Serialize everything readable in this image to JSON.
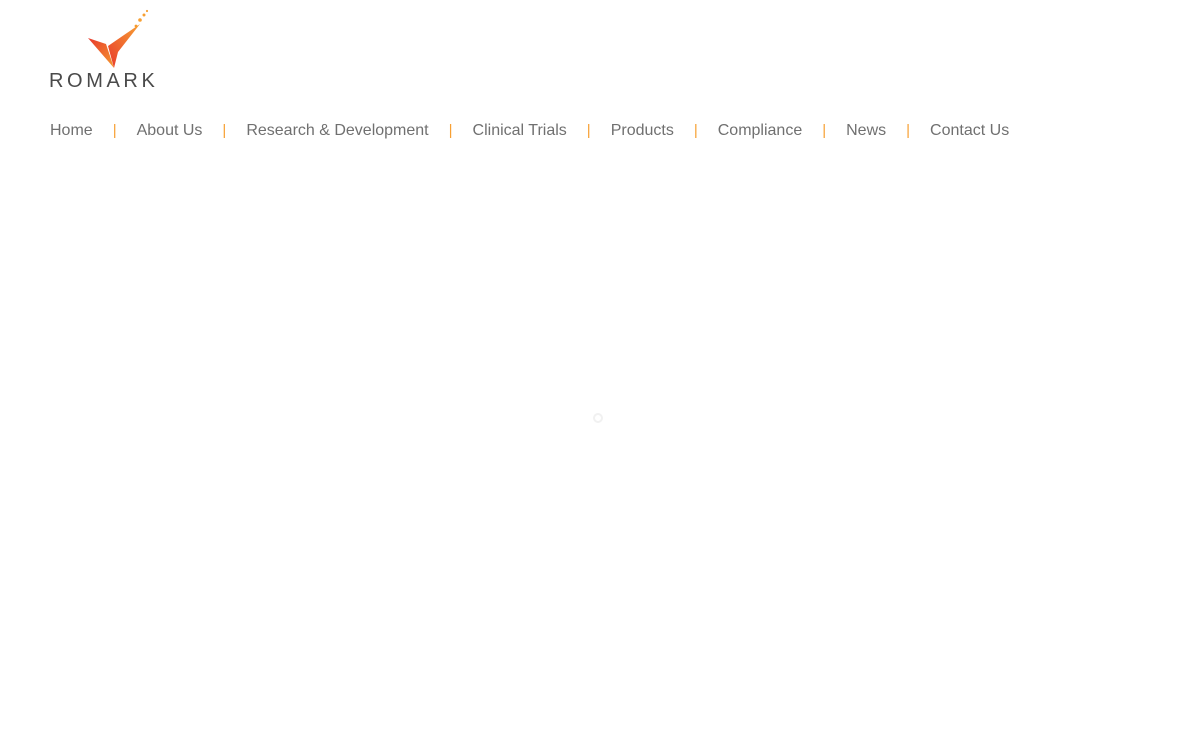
{
  "brand": {
    "logo_text": "ROMARK",
    "colors": {
      "accent_orange": "#f7a033",
      "accent_red": "#e8392c",
      "text_gray": "#707070",
      "wordmark": "#4a4a4a"
    }
  },
  "nav": {
    "items": [
      {
        "label": "Home"
      },
      {
        "label": "About Us"
      },
      {
        "label": "Research & Development"
      },
      {
        "label": "Clinical Trials"
      },
      {
        "label": "Products"
      },
      {
        "label": "Compliance"
      },
      {
        "label": "News"
      },
      {
        "label": "Contact Us"
      }
    ],
    "separator": "|"
  },
  "main": {
    "loader_icon": "loading-spinner-icon"
  }
}
